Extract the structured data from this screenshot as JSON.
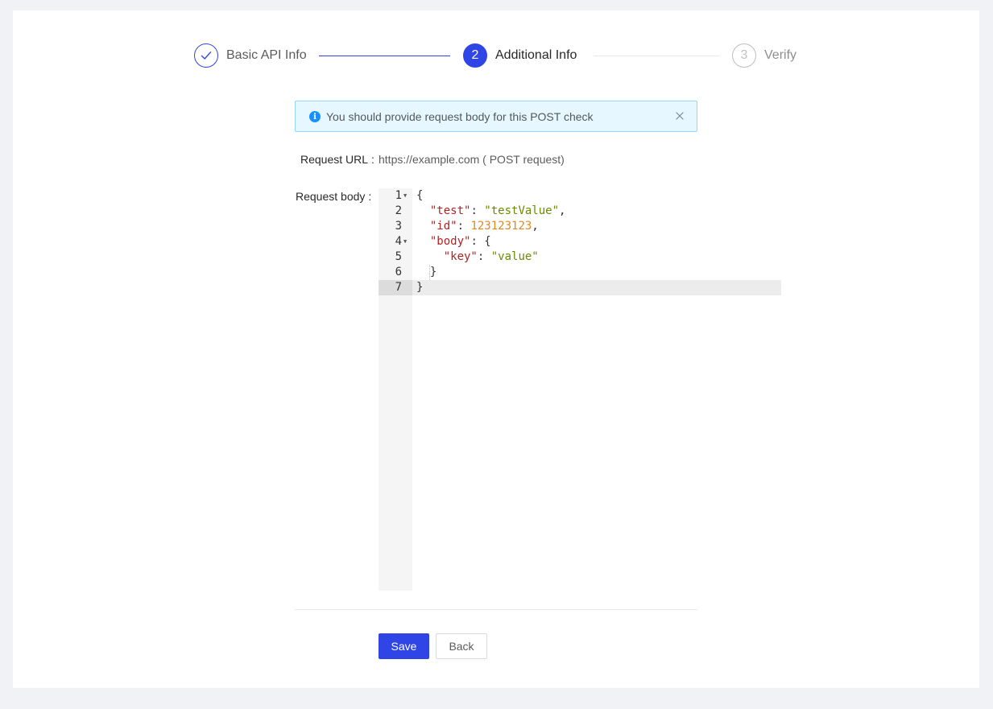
{
  "steps": [
    {
      "title": "Basic API Info",
      "status": "finished",
      "icon": "check-icon"
    },
    {
      "number": "2",
      "title": "Additional Info",
      "status": "active"
    },
    {
      "number": "3",
      "title": "Verify",
      "status": "waiting"
    }
  ],
  "alert": {
    "message": "You should provide request body for this POST check",
    "icon": "info-circle-icon",
    "close_icon": "close-icon"
  },
  "form": {
    "request_url_label": "Request URL",
    "request_url_value": "https://example.com ( POST request)",
    "request_body_label": "Request body",
    "label_colon": ":"
  },
  "editor": {
    "line_numbers": [
      "1",
      "2",
      "3",
      "4",
      "5",
      "6",
      "7"
    ],
    "active_line": "7",
    "fold_markers_on_lines": [
      "1",
      "4"
    ],
    "lines": [
      {
        "parts": [
          {
            "t": "{",
            "k": "punc"
          }
        ]
      },
      {
        "parts": [
          {
            "t": "  ",
            "k": "punc"
          },
          {
            "t": "\"test\"",
            "k": "key"
          },
          {
            "t": ": ",
            "k": "punc"
          },
          {
            "t": "\"testValue\"",
            "k": "str"
          },
          {
            "t": ",",
            "k": "punc"
          }
        ]
      },
      {
        "parts": [
          {
            "t": "  ",
            "k": "punc"
          },
          {
            "t": "\"id\"",
            "k": "key"
          },
          {
            "t": ": ",
            "k": "punc"
          },
          {
            "t": "123123123",
            "k": "num"
          },
          {
            "t": ",",
            "k": "punc"
          }
        ]
      },
      {
        "parts": [
          {
            "t": "  ",
            "k": "punc"
          },
          {
            "t": "\"body\"",
            "k": "key"
          },
          {
            "t": ": {",
            "k": "punc"
          }
        ]
      },
      {
        "parts": [
          {
            "t": "    ",
            "k": "punc"
          },
          {
            "t": "\"key\"",
            "k": "key"
          },
          {
            "t": ": ",
            "k": "punc"
          },
          {
            "t": "\"value\"",
            "k": "str"
          }
        ]
      },
      {
        "parts": [
          {
            "t": "  }",
            "k": "punc"
          }
        ]
      },
      {
        "parts": [
          {
            "t": "}",
            "k": "punc"
          }
        ]
      }
    ]
  },
  "buttons": {
    "save_label": "Save",
    "back_label": "Back"
  },
  "colors": {
    "primary": "#3045e6",
    "alert_bg": "#e6f7ff",
    "alert_border": "#91d5ff",
    "json_key": "#b22222",
    "json_string": "#6a8a00",
    "json_number": "#e2891c"
  }
}
